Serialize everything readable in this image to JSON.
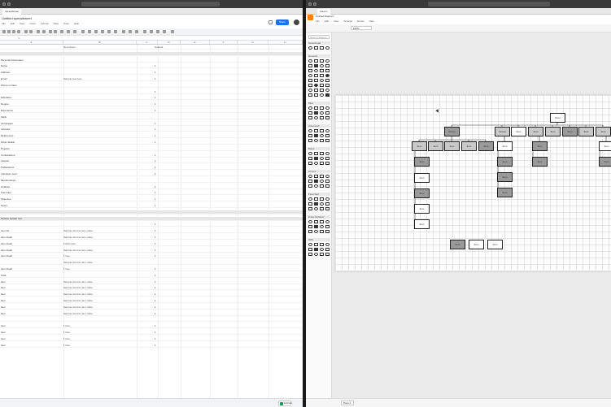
{
  "left_window": {
    "title": "Untitled spreadsheet",
    "tab_label": "Spreadsheet",
    "menu": [
      "File",
      "Edit",
      "View",
      "Insert",
      "Format",
      "Data",
      "Tools",
      "Help"
    ],
    "share_label": "Share",
    "column_headers": [
      "A",
      "B",
      "C",
      "D",
      "E",
      "F",
      "G",
      "H"
    ],
    "rows": [
      {
        "a": "",
        "b": "Description",
        "d": "Amount",
        "band": false
      },
      {
        "a": "",
        "b": "",
        "d": "",
        "band": true
      },
      {
        "a": "Personal Information",
        "b": "",
        "d": "",
        "band": false
      },
      {
        "a": "Name",
        "b": "",
        "d": "1",
        "band": false
      },
      {
        "a": "Address",
        "b": "",
        "d": "1",
        "band": false
      },
      {
        "a": "Email",
        "b": "Sample text here",
        "d": "1",
        "band": false
      },
      {
        "a": "Phone number",
        "b": "",
        "d": "",
        "band": false
      },
      {
        "a": "",
        "b": "",
        "d": "1",
        "band": false
      },
      {
        "a": "Education",
        "b": "",
        "d": "1",
        "band": false
      },
      {
        "a": "Degree",
        "b": "",
        "d": "1",
        "band": false
      },
      {
        "a": "Experience",
        "b": "",
        "d": "1",
        "band": false
      },
      {
        "a": "Skills",
        "b": "",
        "d": "",
        "band": false
      },
      {
        "a": "Languages",
        "b": "",
        "d": "1",
        "band": false
      },
      {
        "a": "Interests",
        "b": "",
        "d": "1",
        "band": false
      },
      {
        "a": "References",
        "b": "",
        "d": "1",
        "band": false
      },
      {
        "a": "Other details",
        "b": "",
        "d": "1",
        "band": false
      },
      {
        "a": "Projects",
        "b": "",
        "d": "",
        "band": false
      },
      {
        "a": "Certifications",
        "b": "",
        "d": "1",
        "band": false
      },
      {
        "a": "Awards",
        "b": "",
        "d": "1",
        "band": false
      },
      {
        "a": "Publications",
        "b": "",
        "d": "1",
        "band": false
      },
      {
        "a": "Volunteer work",
        "b": "",
        "d": "1",
        "band": false
      },
      {
        "a": "Memberships",
        "b": "",
        "d": "",
        "band": false
      },
      {
        "a": "Hobbies",
        "b": "",
        "d": "1",
        "band": false
      },
      {
        "a": "Summary",
        "b": "",
        "d": "1",
        "band": false
      },
      {
        "a": "Objective",
        "b": "",
        "d": "1",
        "band": false
      },
      {
        "a": "Notes",
        "b": "",
        "d": "1",
        "band": false
      },
      {
        "a": "",
        "b": "",
        "d": "",
        "band": true
      },
      {
        "a": "Section header text",
        "b": "",
        "d": "",
        "band": true
      },
      {
        "a": "",
        "b": "",
        "d": "1",
        "band": false
      },
      {
        "a": "Item list",
        "b": "Sample text line item value",
        "d": "1",
        "band": false
      },
      {
        "a": "Item detail",
        "b": "Sample text line item value",
        "d": "1",
        "band": false
      },
      {
        "a": "Item detail",
        "b": "1,000 units",
        "d": "1",
        "band": false
      },
      {
        "a": "Item detail",
        "b": "Sample text line item value",
        "d": "1",
        "band": false
      },
      {
        "a": "Item detail",
        "b": "1 item",
        "d": "1",
        "band": false
      },
      {
        "a": "",
        "b": "Sample text line item value",
        "d": "",
        "band": false
      },
      {
        "a": "Item detail",
        "b": "1 item",
        "d": "1",
        "band": false
      },
      {
        "a": "Total",
        "b": "",
        "d": "1",
        "band": false
      },
      {
        "a": "Item",
        "b": "Sample text line item value",
        "d": "1",
        "band": false
      },
      {
        "a": "Item",
        "b": "Sample text line item value",
        "d": "1",
        "band": false
      },
      {
        "a": "Item",
        "b": "Sample text line item value",
        "d": "1",
        "band": false
      },
      {
        "a": "Item",
        "b": "Sample text line item value",
        "d": "1",
        "band": false
      },
      {
        "a": "Item",
        "b": "Sample text line item value",
        "d": "1",
        "band": false
      },
      {
        "a": "Item",
        "b": "Sample text line item value",
        "d": "1",
        "band": false
      },
      {
        "a": "",
        "b": "",
        "d": "",
        "band": false
      },
      {
        "a": "Item",
        "b": "1 item",
        "d": "1",
        "band": false
      },
      {
        "a": "Item",
        "b": "1 item",
        "d": "1",
        "band": false
      },
      {
        "a": "Item",
        "b": "1 item",
        "d": "1",
        "band": false
      },
      {
        "a": "Item",
        "b": "1 item",
        "d": "1",
        "band": false
      }
    ],
    "explore_label": "Explore"
  },
  "right_window": {
    "tab_label": "draw.io",
    "title": "Untitled Diagram",
    "menu": [
      "File",
      "Edit",
      "View",
      "Arrange",
      "Extras",
      "Help"
    ],
    "zoom": "100%",
    "search_placeholder": "Search Shapes",
    "sections": [
      "Scratchpad",
      "General",
      "Misc",
      "Advanced",
      "Basic",
      "Arrows",
      "Flowchart",
      "Entity Relation",
      "UML"
    ],
    "page_tab": "Page-1",
    "nodes": [
      {
        "label": "Root",
        "shade": "lt"
      },
      {
        "label": "Group",
        "shade": "dk"
      },
      {
        "label": "Group",
        "shade": "md"
      },
      {
        "label": "Item",
        "shade": "lt"
      },
      {
        "label": "Item",
        "shade": "md"
      },
      {
        "label": "Item",
        "shade": "md"
      },
      {
        "label": "Item",
        "shade": "dk"
      },
      {
        "label": "Item",
        "shade": "md"
      },
      {
        "label": "Item",
        "shade": "md"
      },
      {
        "label": "Item",
        "shade": "md"
      },
      {
        "label": "Item",
        "shade": "md"
      },
      {
        "label": "Item",
        "shade": "md"
      },
      {
        "label": "Item",
        "shade": "md"
      },
      {
        "label": "Item",
        "shade": "dk"
      },
      {
        "label": "Item",
        "shade": "lt"
      },
      {
        "label": "Item",
        "shade": "dk"
      },
      {
        "label": "Item",
        "shade": "lt"
      },
      {
        "label": "Item",
        "shade": "dk"
      },
      {
        "label": "Item",
        "shade": "dk"
      },
      {
        "label": "Item",
        "shade": "dk"
      },
      {
        "label": "Item",
        "shade": "lt"
      },
      {
        "label": "Item",
        "shade": "dk"
      },
      {
        "label": "Item",
        "shade": "dk"
      },
      {
        "label": "Item",
        "shade": "dk"
      },
      {
        "label": "Item",
        "shade": "dk"
      },
      {
        "label": "Item",
        "shade": "lt"
      },
      {
        "label": "Item",
        "shade": "lt"
      }
    ]
  }
}
